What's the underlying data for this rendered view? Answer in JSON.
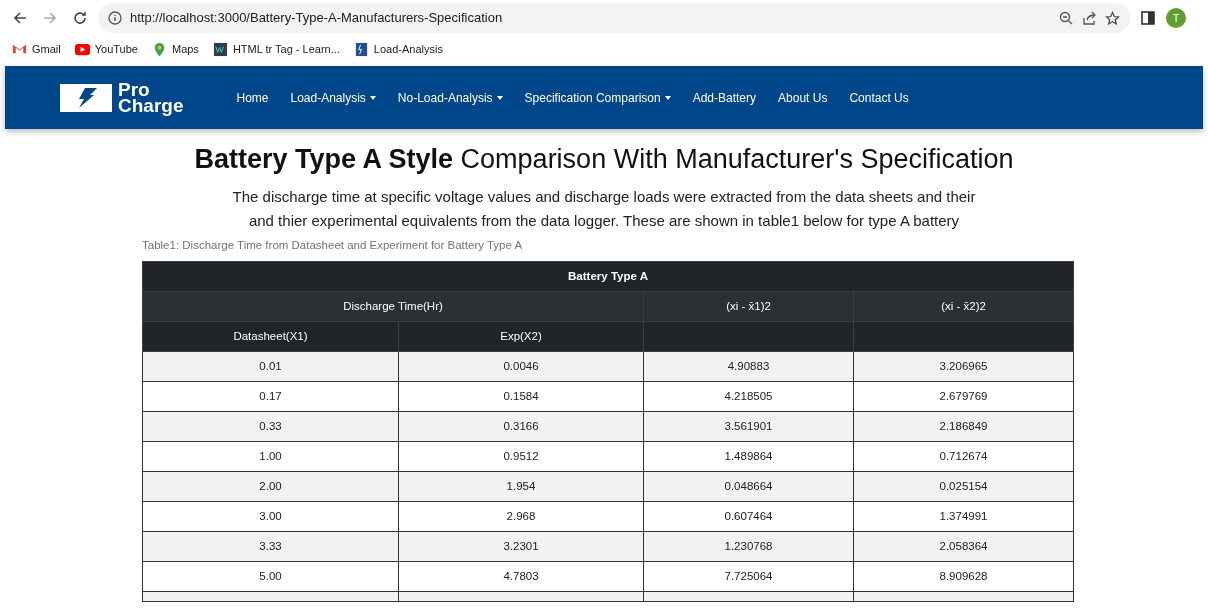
{
  "browser": {
    "url": "http://localhost:3000/Battery-Type-A-Manufacturers-Specification",
    "profile_initial": "T",
    "bookmarks": [
      {
        "label": "Gmail",
        "kind": "gmail"
      },
      {
        "label": "YouTube",
        "kind": "youtube"
      },
      {
        "label": "Maps",
        "kind": "maps"
      },
      {
        "label": "HTML tr Tag - Learn...",
        "kind": "w3"
      },
      {
        "label": "Load-Analysis",
        "kind": "site"
      }
    ]
  },
  "navbar": {
    "brand_line_1": "Pro",
    "brand_line_2": "Charge",
    "items": [
      {
        "label": "Home",
        "dropdown": false
      },
      {
        "label": "Load-Analysis",
        "dropdown": true
      },
      {
        "label": "No-Load-Analysis",
        "dropdown": true
      },
      {
        "label": "Specification Comparison",
        "dropdown": true
      },
      {
        "label": "Add-Battery",
        "dropdown": false
      },
      {
        "label": "About Us",
        "dropdown": false
      },
      {
        "label": "Contact Us",
        "dropdown": false
      }
    ]
  },
  "heading": "**Battery Type A Style** Comparison With Manufacturer's Specification",
  "intro": [
    "The discharge time at specific voltage values and discharge loads were extracted from the data sheets and their",
    "and thier experimental equivalents from the data logger. These are shown in table1 below for type A battery"
  ],
  "table": {
    "caption": "Table1: Discharge Time from Datasheet and Experiment for Battery Type A",
    "title": "Battery Type A",
    "group_header": "Discharge Time(Hr)",
    "header_3": "(xi - x̄1)2",
    "header_4": "(xi - x̄2)2",
    "columns": [
      "Datasheet(X1)",
      "Exp(X2)"
    ],
    "rows": [
      [
        "0.01",
        "0.0046",
        "4.90883",
        "3.206965"
      ],
      [
        "0.17",
        "0.1584",
        "4.218505",
        "2.679769"
      ],
      [
        "0.33",
        "0.3166",
        "3.561901",
        "2.186849"
      ],
      [
        "1.00",
        "0.9512",
        "1.489864",
        "0.712674"
      ],
      [
        "2.00",
        "1.954",
        "0.048664",
        "0.025154"
      ],
      [
        "3.00",
        "2.968",
        "0.607464",
        "1.374991"
      ],
      [
        "3.33",
        "3.2301",
        "1.230768",
        "2.058364"
      ],
      [
        "5.00",
        "4.7803",
        "7.725064",
        "8.909628"
      ]
    ]
  }
}
